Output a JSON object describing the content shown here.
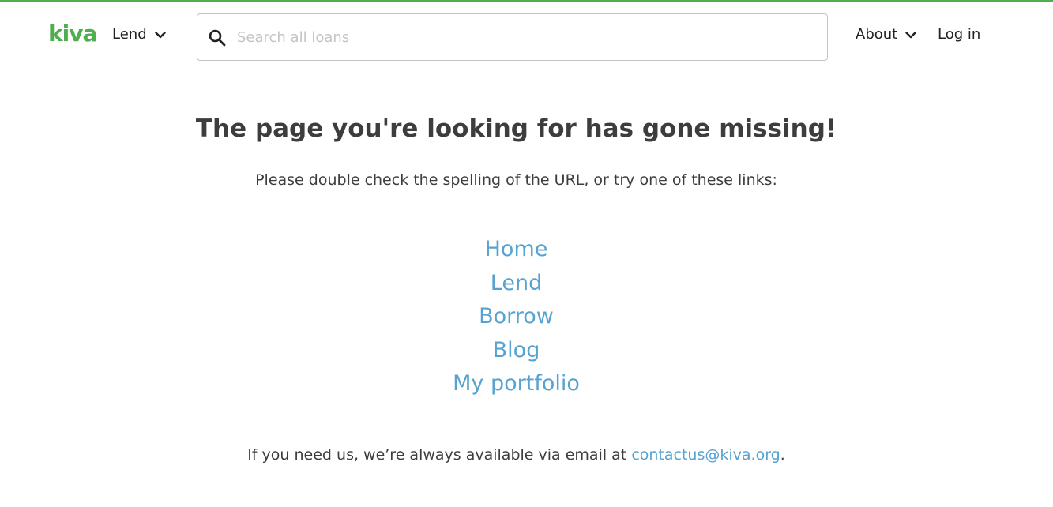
{
  "header": {
    "logo_text": "kiva",
    "lend_label": "Lend",
    "about_label": "About",
    "login_label": "Log in",
    "search": {
      "placeholder": "Search all loans",
      "value": ""
    }
  },
  "main": {
    "title": "The page you're looking for has gone missing!",
    "subtitle": "Please double check the spelling of the URL, or try one of these links:",
    "links": [
      "Home",
      "Lend",
      "Borrow",
      "Blog",
      "My portfolio"
    ],
    "contact_prefix": "If you need us, we’re always available via email at",
    "contact_email": "contactus@kiva.org",
    "contact_suffix": "."
  },
  "colors": {
    "brand_green": "#4faf4e",
    "link_blue": "#57a2d0",
    "text_dark": "#3d3d3d"
  },
  "icons": [
    "search-icon",
    "chevron-down-icon"
  ]
}
